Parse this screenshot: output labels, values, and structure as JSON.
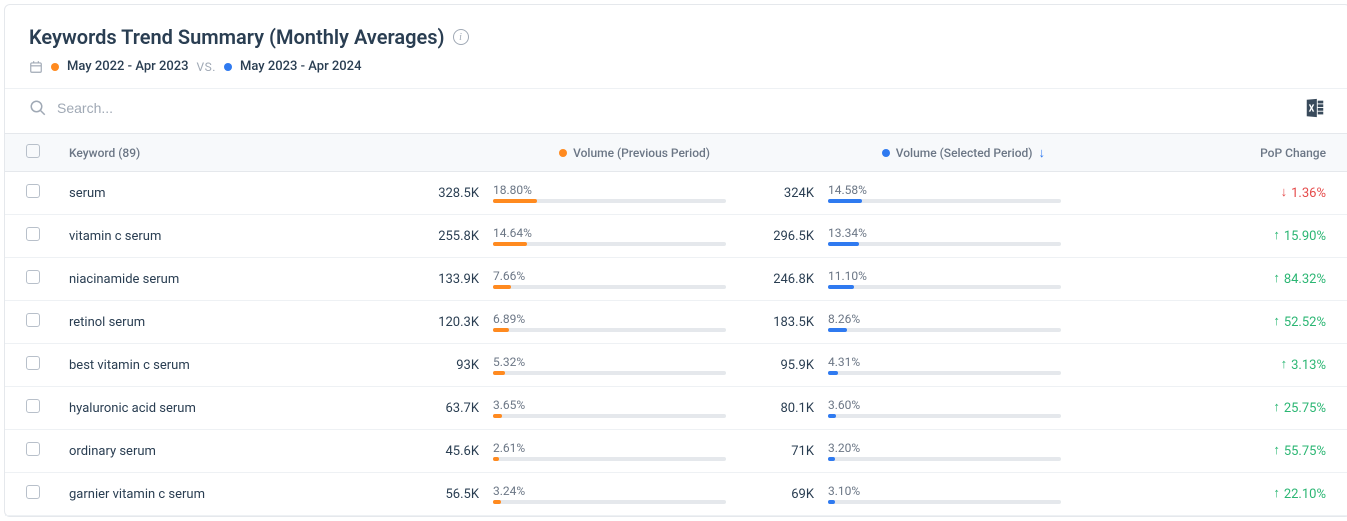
{
  "header": {
    "title": "Keywords Trend Summary (Monthly Averages)",
    "period1": "May 2022 - Apr 2023",
    "vs": "VS.",
    "period2": "May 2023 - Apr 2024"
  },
  "search": {
    "placeholder": "Search..."
  },
  "columns": {
    "keyword": "Keyword (89)",
    "vol_prev": "Volume (Previous Period)",
    "vol_sel": "Volume (Selected Period)",
    "pop": "PoP Change"
  },
  "colors": {
    "orange": "#ff8a1f",
    "blue": "#2f7af0"
  },
  "rows": [
    {
      "keyword": "serum",
      "prev_vol": "328.5K",
      "prev_pct": "18.80%",
      "prev_bar": 18.8,
      "sel_vol": "324K",
      "sel_pct": "14.58%",
      "sel_bar": 14.58,
      "pop": "1.36%",
      "dir": "down"
    },
    {
      "keyword": "vitamin c serum",
      "prev_vol": "255.8K",
      "prev_pct": "14.64%",
      "prev_bar": 14.64,
      "sel_vol": "296.5K",
      "sel_pct": "13.34%",
      "sel_bar": 13.34,
      "pop": "15.90%",
      "dir": "up"
    },
    {
      "keyword": "niacinamide serum",
      "prev_vol": "133.9K",
      "prev_pct": "7.66%",
      "prev_bar": 7.66,
      "sel_vol": "246.8K",
      "sel_pct": "11.10%",
      "sel_bar": 11.1,
      "pop": "84.32%",
      "dir": "up"
    },
    {
      "keyword": "retinol serum",
      "prev_vol": "120.3K",
      "prev_pct": "6.89%",
      "prev_bar": 6.89,
      "sel_vol": "183.5K",
      "sel_pct": "8.26%",
      "sel_bar": 8.26,
      "pop": "52.52%",
      "dir": "up"
    },
    {
      "keyword": "best vitamin c serum",
      "prev_vol": "93K",
      "prev_pct": "5.32%",
      "prev_bar": 5.32,
      "sel_vol": "95.9K",
      "sel_pct": "4.31%",
      "sel_bar": 4.31,
      "pop": "3.13%",
      "dir": "up"
    },
    {
      "keyword": "hyaluronic acid serum",
      "prev_vol": "63.7K",
      "prev_pct": "3.65%",
      "prev_bar": 3.65,
      "sel_vol": "80.1K",
      "sel_pct": "3.60%",
      "sel_bar": 3.6,
      "pop": "25.75%",
      "dir": "up"
    },
    {
      "keyword": "ordinary serum",
      "prev_vol": "45.6K",
      "prev_pct": "2.61%",
      "prev_bar": 2.61,
      "sel_vol": "71K",
      "sel_pct": "3.20%",
      "sel_bar": 3.2,
      "pop": "55.75%",
      "dir": "up"
    },
    {
      "keyword": "garnier vitamin c serum",
      "prev_vol": "56.5K",
      "prev_pct": "3.24%",
      "prev_bar": 3.24,
      "sel_vol": "69K",
      "sel_pct": "3.10%",
      "sel_bar": 3.1,
      "pop": "22.10%",
      "dir": "up"
    }
  ]
}
